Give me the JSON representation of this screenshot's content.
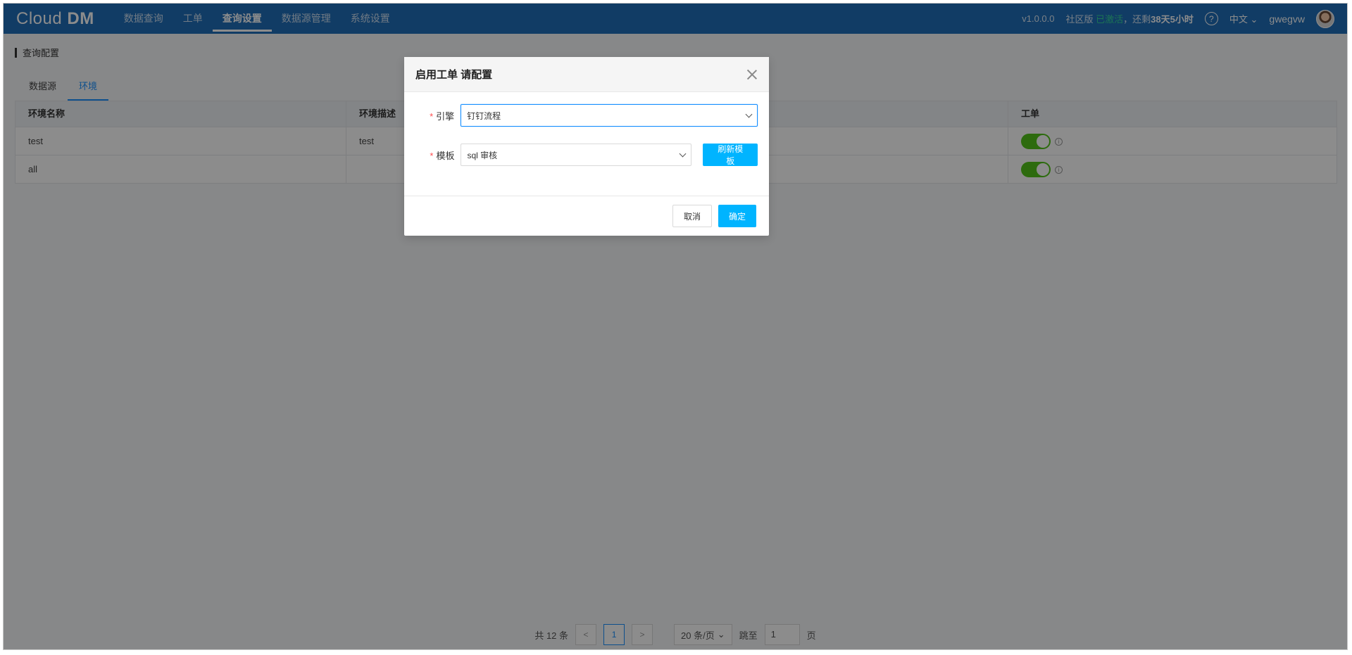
{
  "header": {
    "logo_main": "Cloud ",
    "logo_bold": "DM",
    "nav": [
      "数据查询",
      "工单",
      "查询设置",
      "数据源管理",
      "系统设置"
    ],
    "active_nav_index": 2,
    "version": "v1.0.0.0",
    "edition_prefix": "社区版 ",
    "edition_status": "已激活",
    "edition_sep": "，还剩",
    "edition_remaining": "38天5小时",
    "help_icon": "?",
    "language": "中文",
    "username": "gwegvw"
  },
  "page": {
    "title": "查询配置",
    "tabs": [
      "数据源",
      "环境"
    ],
    "active_tab_index": 1
  },
  "table": {
    "headers": [
      "环境名称",
      "环境描述",
      "",
      "工单"
    ],
    "rows": [
      {
        "name": "test",
        "desc": "test",
        "workflow_enabled": true
      },
      {
        "name": "all",
        "desc": "",
        "workflow_enabled": true
      }
    ]
  },
  "pagination": {
    "total": "共 12 条",
    "prev": "<",
    "current_page": "1",
    "next": ">",
    "page_size": "20 条/页",
    "jump_label": "跳至",
    "jump_value": "1",
    "page_unit": "页"
  },
  "modal": {
    "title": "启用工单 请配置",
    "engine_label": "引擎",
    "engine_value": "钉钉流程",
    "template_label": "模板",
    "template_value": "sql 审核",
    "refresh_button": "刷新模板",
    "cancel_button": "取消",
    "confirm_button": "确定"
  },
  "colors": {
    "header_bg": "#1f6db9",
    "primary": "#00b4ff",
    "switch_on": "#52c41a",
    "required": "#ff4d4f"
  }
}
